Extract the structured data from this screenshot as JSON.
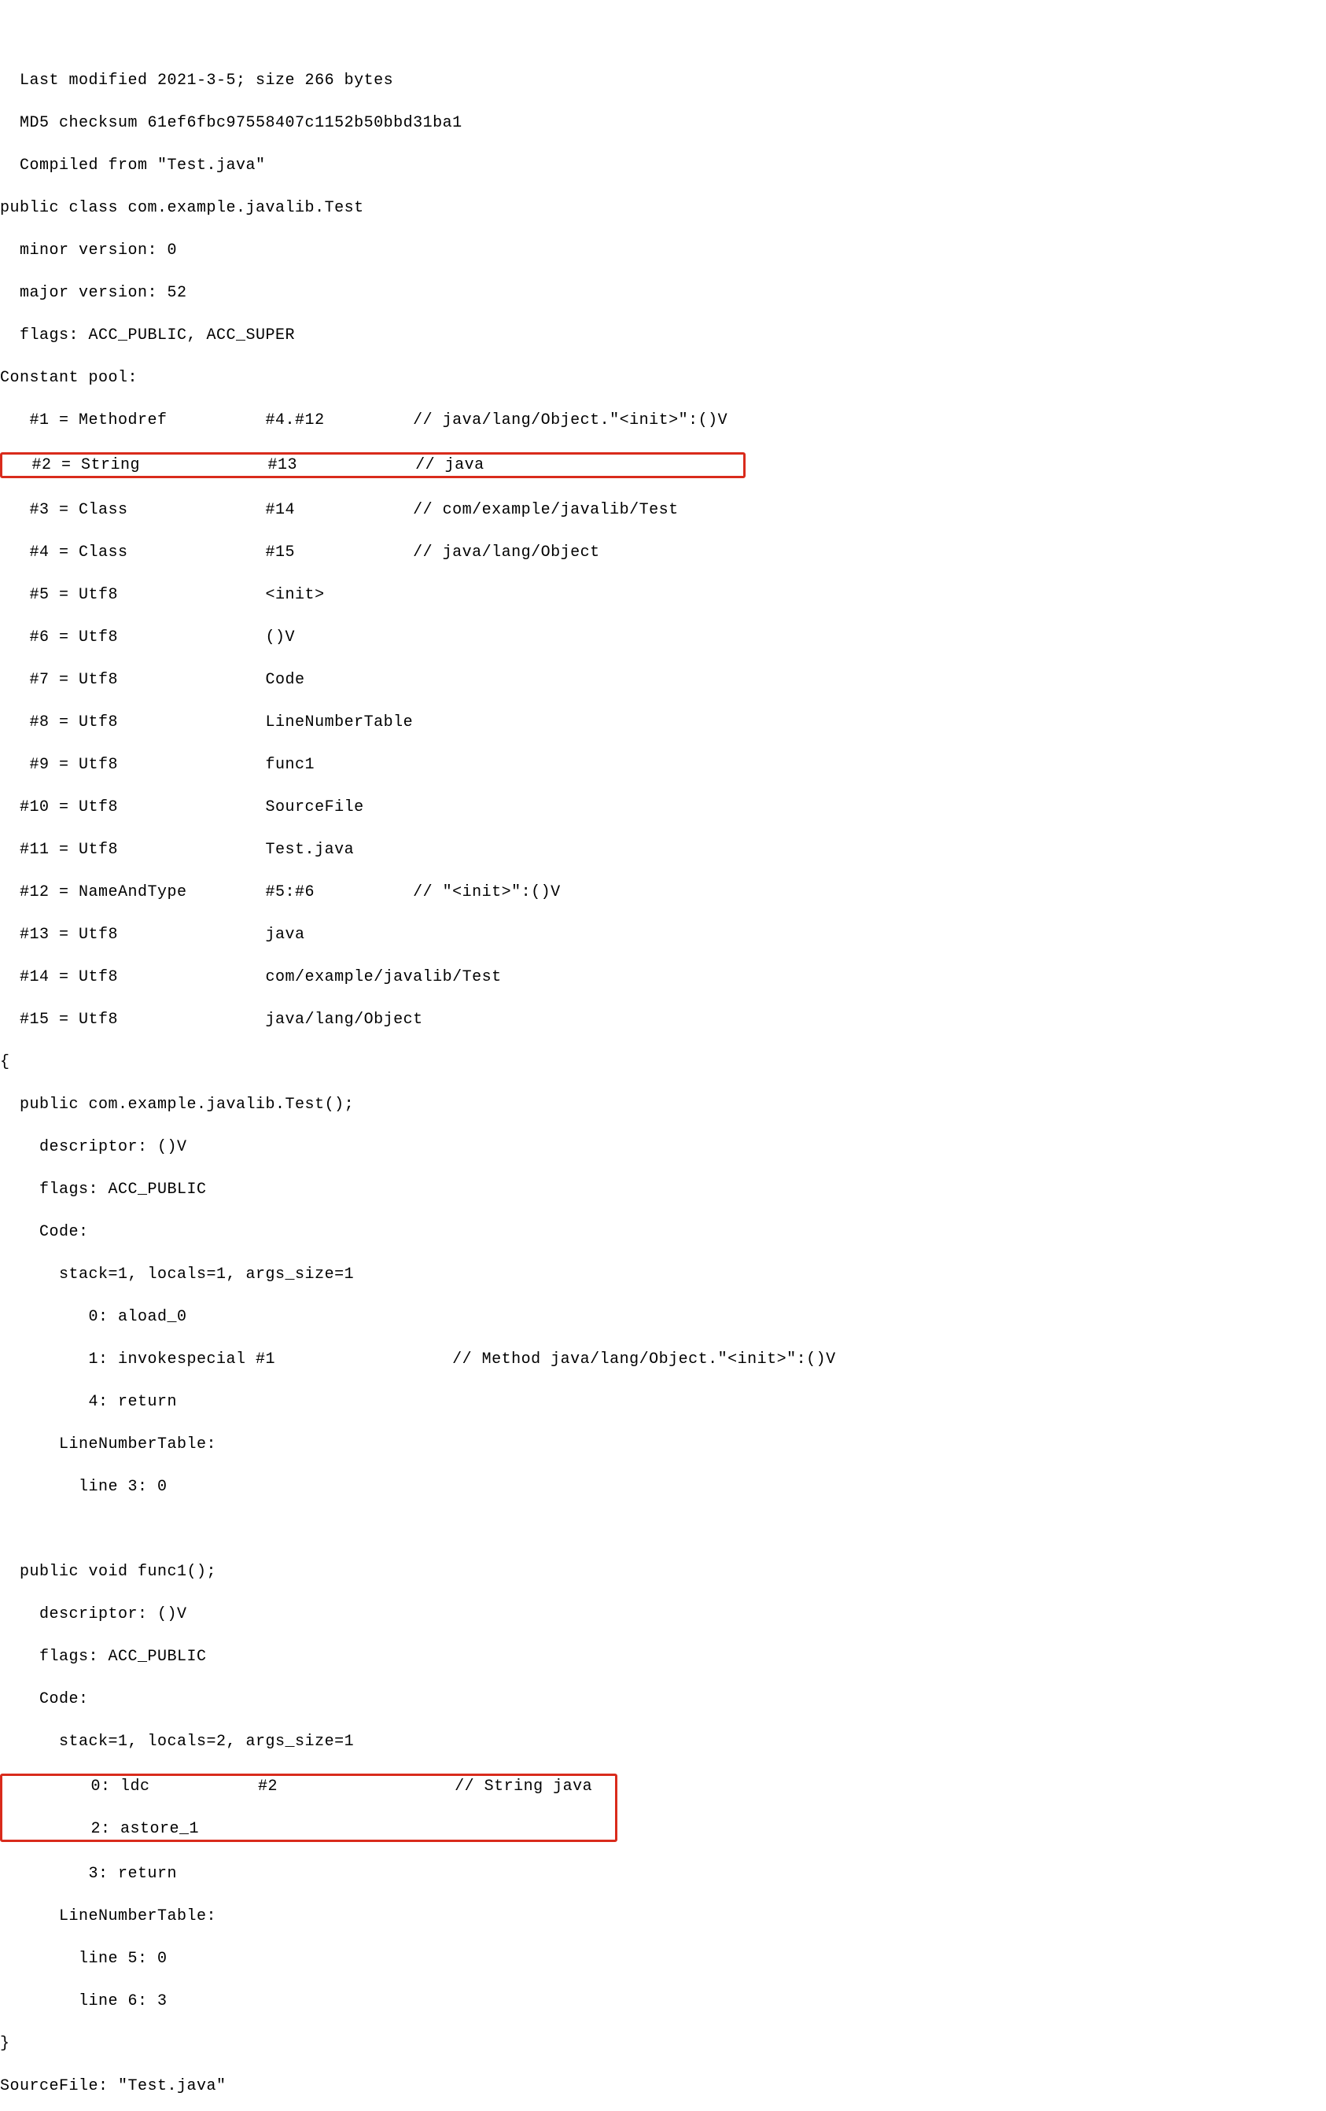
{
  "header": {
    "lastModified": "  Last modified 2021-3-5; size 266 bytes",
    "md5": "  MD5 checksum 61ef6fbc97558407c1152b50bbd31ba1",
    "compiledFrom": "  Compiled from \"Test.java\"",
    "publicClass": "public class com.example.javalib.Test",
    "minor": "  minor version: 0",
    "major": "  major version: 52",
    "flags": "  flags: ACC_PUBLIC, ACC_SUPER"
  },
  "constantPoolHeader": "Constant pool:",
  "constantPool": {
    "c1": "   #1 = Methodref          #4.#12         // java/lang/Object.\"<init>\":()V",
    "c2": "   #2 = String             #13            // java                          ",
    "c3": "   #3 = Class              #14            // com/example/javalib/Test",
    "c4": "   #4 = Class              #15            // java/lang/Object",
    "c5": "   #5 = Utf8               <init>",
    "c6": "   #6 = Utf8               ()V",
    "c7": "   #7 = Utf8               Code",
    "c8": "   #8 = Utf8               LineNumberTable",
    "c9": "   #9 = Utf8               func1",
    "c10": "  #10 = Utf8               SourceFile",
    "c11": "  #11 = Utf8               Test.java",
    "c12": "  #12 = NameAndType        #5:#6          // \"<init>\":()V",
    "c13": "  #13 = Utf8               java",
    "c14": "  #14 = Utf8               com/example/javalib/Test",
    "c15": "  #15 = Utf8               java/lang/Object"
  },
  "openBrace": "{",
  "method1": {
    "sig": "  public com.example.javalib.Test();",
    "desc": "    descriptor: ()V",
    "flg": "    flags: ACC_PUBLIC",
    "code": "    Code:",
    "stk": "      stack=1, locals=1, args_size=1",
    "b0": "         0: aload_0",
    "b1": "         1: invokespecial #1                  // Method java/lang/Object.\"<init>\":()V",
    "b4": "         4: return",
    "lnt": "      LineNumberTable:",
    "ln3": "        line 3: 0"
  },
  "blank": " ",
  "method2": {
    "sig": "  public void func1();",
    "desc": "    descriptor: ()V",
    "flg": "    flags: ACC_PUBLIC",
    "code": "    Code:",
    "stk": "      stack=1, locals=2, args_size=1",
    "b0": "         0: ldc           #2                  // String java  ",
    "b2": "         2: astore_1                                          ",
    "b3": "         3: return",
    "lnt": "      LineNumberTable:",
    "ln5": "        line 5: 0",
    "ln6": "        line 6: 3"
  },
  "closeBrace": "}",
  "sourceFile": "SourceFile: \"Test.java\""
}
